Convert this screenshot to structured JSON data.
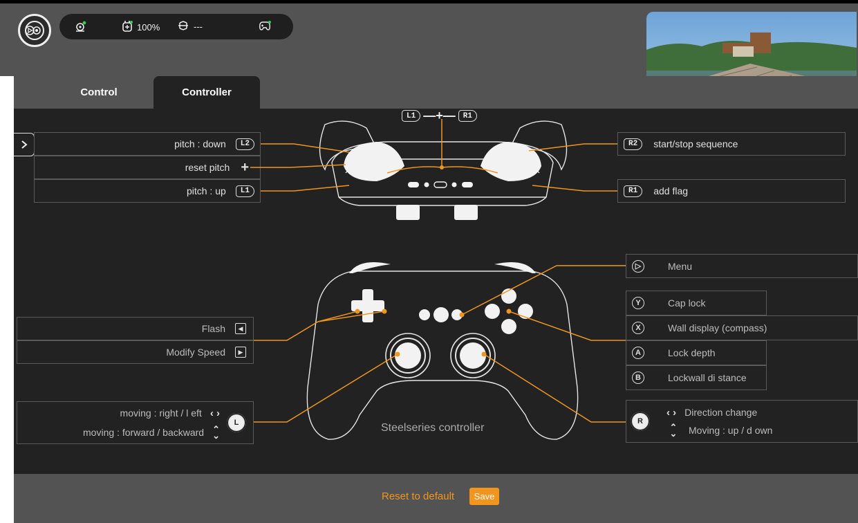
{
  "header": {
    "status": {
      "battery_text": "100%",
      "link_text": "---"
    },
    "icons": [
      "logo-icon",
      "robot-status-icon",
      "battery-icon",
      "drone-link-icon",
      "gamepad-icon"
    ]
  },
  "tabs": [
    {
      "label": "Control",
      "active": false
    },
    {
      "label": "Controller",
      "active": true
    }
  ],
  "top_controller": {
    "combo": {
      "left": "L1",
      "right": "R1"
    },
    "left_rows": [
      {
        "text": "pitch : down",
        "badge": "L2"
      },
      {
        "text": "reset pitch",
        "badge": "+"
      },
      {
        "text": "pitch : up",
        "badge": "L1"
      }
    ],
    "right_rows": [
      {
        "badge": "R2",
        "text": "start/stop sequence"
      },
      {
        "badge": "R1",
        "text": "add flag"
      }
    ]
  },
  "gamepad": {
    "caption": "Steelseries controller",
    "left_rows": [
      {
        "text": "Flash",
        "icon": "◀"
      },
      {
        "text": "Modify Speed",
        "icon": "▶"
      }
    ],
    "left_stick": {
      "lines": [
        "moving : right / l eft",
        "moving :  forward / backward"
      ],
      "button": "L"
    },
    "right_rows": [
      {
        "icon": "▷",
        "text": "Menu"
      },
      {
        "icon": "Y",
        "text": "Cap lock"
      },
      {
        "icon": "X",
        "text": "Wall display (compass)"
      },
      {
        "icon": "A",
        "text": "Lock depth"
      },
      {
        "icon": "B",
        "text": "Lockwall di stance"
      }
    ],
    "right_stick": {
      "lines": [
        "Direction change",
        "Moving : up / d own"
      ],
      "button": "R"
    }
  },
  "footer": {
    "reset_label": "Reset to default",
    "save_label": "Save"
  },
  "colors": {
    "accent": "#f0961e",
    "panel": "#222222",
    "chrome": "#535353"
  }
}
